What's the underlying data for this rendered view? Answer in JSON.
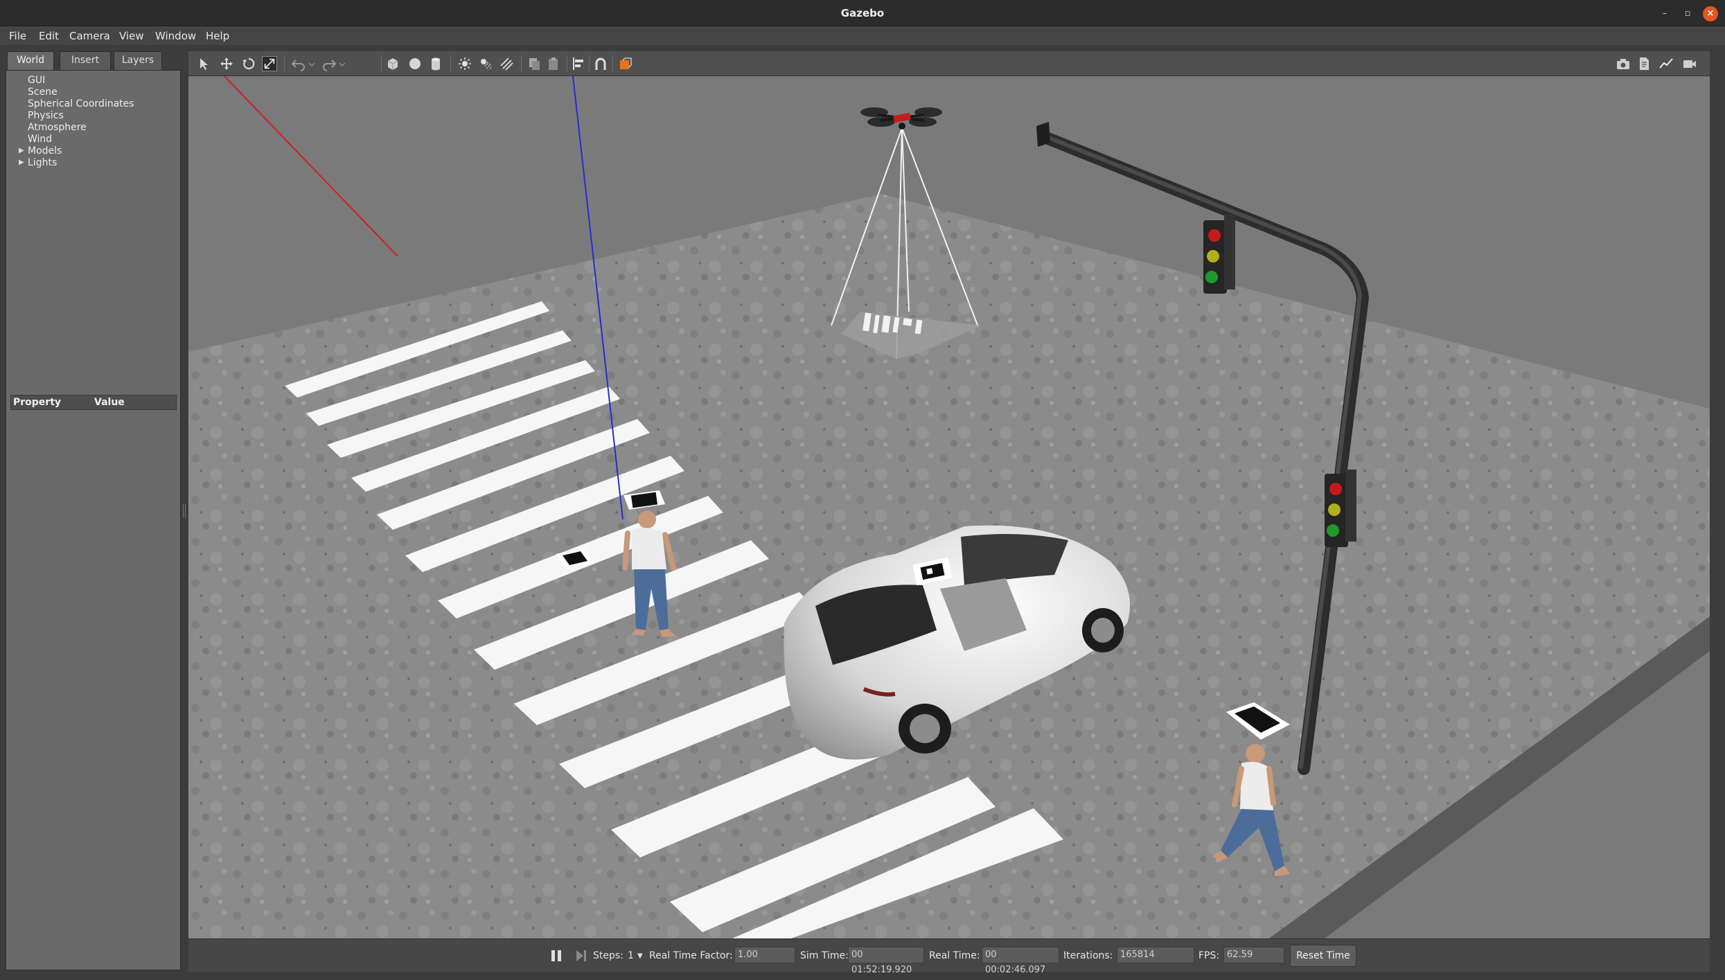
{
  "window": {
    "title": "Gazebo"
  },
  "menu": [
    "File",
    "Edit",
    "Camera",
    "View",
    "Window",
    "Help"
  ],
  "left_panel": {
    "tabs": [
      "World",
      "Insert",
      "Layers"
    ],
    "active_tab": "World",
    "tree": [
      "GUI",
      "Scene",
      "Spherical Coordinates",
      "Physics",
      "Atmosphere",
      "Wind",
      "Models",
      "Lights"
    ],
    "property_header": {
      "property": "Property",
      "value": "Value"
    }
  },
  "toolbar": {
    "icons": [
      "select-icon",
      "translate-icon",
      "rotate-icon",
      "scale-icon",
      "undo-icon",
      "redo-icon",
      "box-icon",
      "sphere-icon",
      "cylinder-icon",
      "point-light-icon",
      "spot-light-icon",
      "directional-light-icon",
      "copy-icon",
      "paste-icon",
      "align-icon",
      "snap-icon",
      "view-angle-icon",
      "screenshot-icon",
      "log-icon",
      "plot-icon",
      "video-icon"
    ]
  },
  "bottom_bar": {
    "steps_label": "Steps:",
    "steps_value": "1",
    "rtf_label": "Real Time Factor:",
    "rtf_value": "1.00",
    "sim_label": "Sim Time:",
    "sim_value": "00 01:52:19.920",
    "real_label": "Real Time:",
    "real_value": "00 00:02:46.097",
    "iter_label": "Iterations:",
    "iter_value": "165814",
    "fps_label": "FPS:",
    "fps_value": "62.59",
    "reset_label": "Reset Time"
  },
  "colors": {
    "accent_orange": "#e95420",
    "ground": "#8e8e8e",
    "sky": "#7a7a7a"
  }
}
